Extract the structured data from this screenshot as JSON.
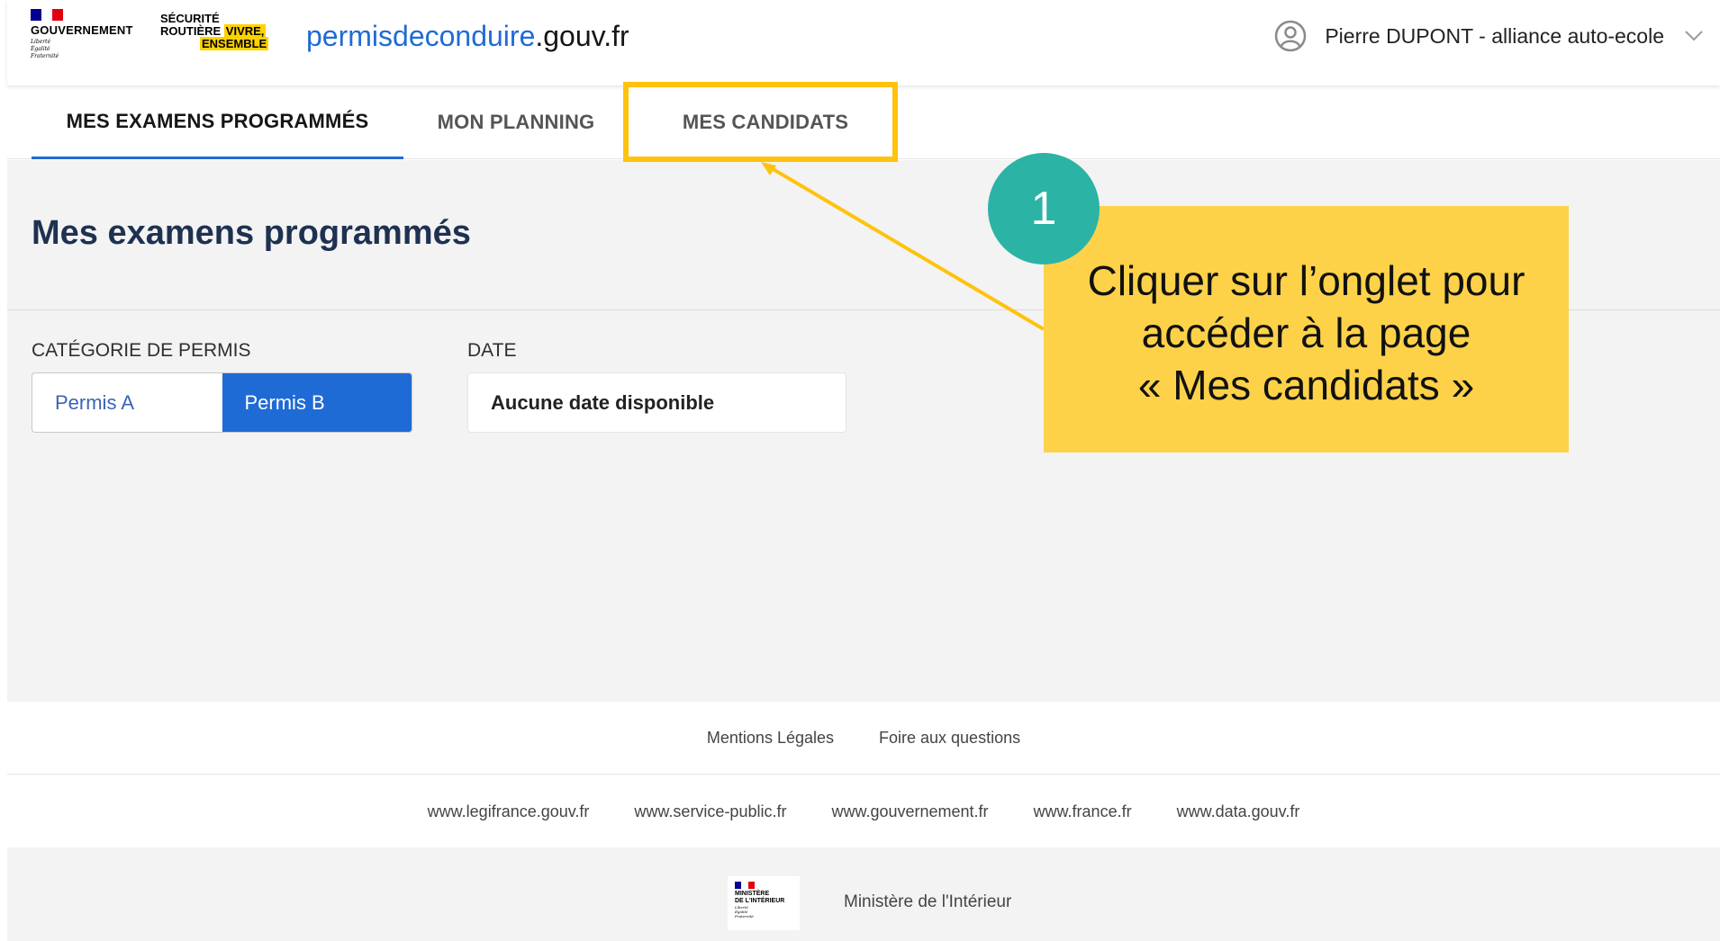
{
  "header": {
    "gov_logo": {
      "name": "GOUVERNEMENT",
      "motto_lines": [
        "Liberté",
        "Égalité",
        "Fraternité"
      ],
      "flag_colors": [
        "#000091",
        "#ffffff",
        "#e1000f"
      ]
    },
    "sr_logo": {
      "line1": "SÉCURITÉ",
      "line2": "ROUTIÈRE",
      "line2_highlight": "VIVRE,",
      "line3_highlight": "ENSEMBLE"
    },
    "site_title": {
      "main": "permisdeconduire",
      "suffix": ".gouv.fr"
    },
    "user": {
      "name": "Pierre DUPONT - alliance auto-ecole",
      "avatar_icon": "user-circle-icon",
      "dropdown_icon": "chevron-down-icon"
    }
  },
  "tabs": [
    {
      "label": "MES EXAMENS PROGRAMMÉS",
      "active": true
    },
    {
      "label": "MON PLANNING",
      "active": false
    },
    {
      "label": "MES CANDIDATS",
      "active": false
    }
  ],
  "main": {
    "page_title": "Mes examens programmés",
    "category": {
      "label": "CATÉGORIE DE PERMIS",
      "options": [
        "Permis A",
        "Permis B"
      ],
      "selected": "Permis B"
    },
    "date": {
      "label": "DATE",
      "value": "Aucune date disponible"
    }
  },
  "footer": {
    "links": [
      "Mentions Légales",
      "Foire aux questions"
    ],
    "sites": [
      "www.legifrance.gouv.fr",
      "www.service-public.fr",
      "www.gouvernement.fr",
      "www.france.fr",
      "www.data.gouv.fr"
    ],
    "ministry_logo": {
      "name_lines": [
        "MINISTÈRE",
        "DE L'INTÉRIEUR"
      ],
      "motto_lines": [
        "Liberté",
        "Égalité",
        "Fraternité"
      ]
    },
    "ministry": "Ministère de l'Intérieur"
  },
  "annotation": {
    "step_number": "1",
    "text_lines": [
      "Cliquer sur l’onglet pour",
      "accéder à la page",
      "« Mes candidats »"
    ],
    "highlight_color": "#ffc20e",
    "callout_color": "#fdd249",
    "badge_color": "#2bb3a6"
  },
  "colors": {
    "primary": "#1f6bd6",
    "title": "#1e3151",
    "background": "#f3f3f3"
  }
}
